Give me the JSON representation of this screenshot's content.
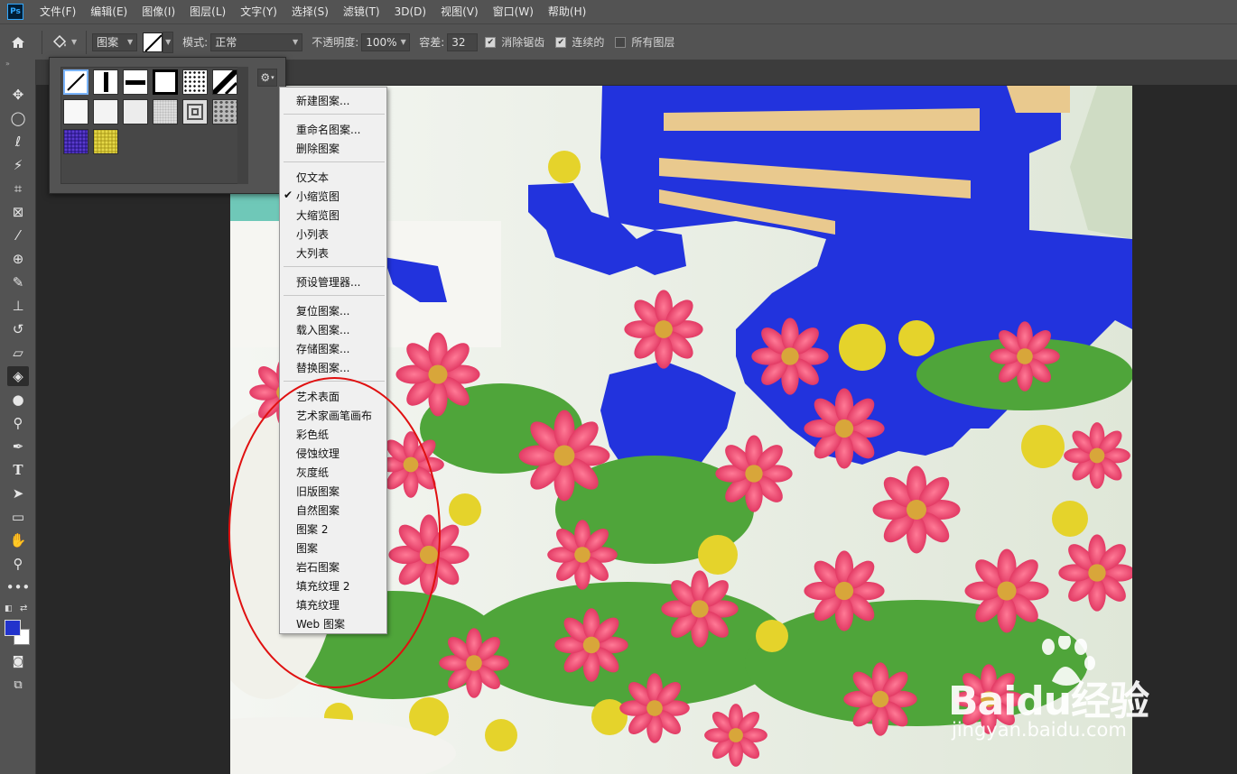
{
  "app": {
    "logo": "Ps"
  },
  "menubar": {
    "items": [
      "文件(F)",
      "编辑(E)",
      "图像(I)",
      "图层(L)",
      "文字(Y)",
      "选择(S)",
      "滤镜(T)",
      "3D(D)",
      "视图(V)",
      "窗口(W)",
      "帮助(H)"
    ]
  },
  "options": {
    "fill_source": "图案",
    "mode_label": "模式:",
    "mode_value": "正常",
    "opacity_label": "不透明度:",
    "opacity_value": "100%",
    "tolerance_label": "容差:",
    "tolerance_value": "32",
    "antialias_label": "消除锯齿",
    "antialias_checked": true,
    "contiguous_label": "连续的",
    "contiguous_checked": true,
    "all_layers_label": "所有图层",
    "all_layers_checked": false
  },
  "foreground_color": "#2233cc",
  "background_color": "#ffffff",
  "context_menu": {
    "new_pattern": "新建图案...",
    "rename_pattern": "重命名图案...",
    "delete_pattern": "删除图案",
    "text_only": "仅文本",
    "small_thumbnail": "小缩览图",
    "small_thumbnail_checked": true,
    "large_thumbnail": "大缩览图",
    "small_list": "小列表",
    "large_list": "大列表",
    "preset_manager": "预设管理器...",
    "reset_patterns": "复位图案...",
    "load_patterns": "载入图案...",
    "save_patterns": "存储图案...",
    "replace_patterns": "替换图案...",
    "libraries": [
      "艺术表面",
      "艺术家画笔画布",
      "彩色纸",
      "侵蚀纹理",
      "灰度纸",
      "旧版图案",
      "自然图案",
      "图案 2",
      "图案",
      "岩石图案",
      "填充纹理 2",
      "填充纹理",
      "Web 图案"
    ]
  },
  "watermark": {
    "logo": "Baidu经验",
    "url": "jingyan.baidu.com"
  },
  "highlight_color": "#e01010"
}
